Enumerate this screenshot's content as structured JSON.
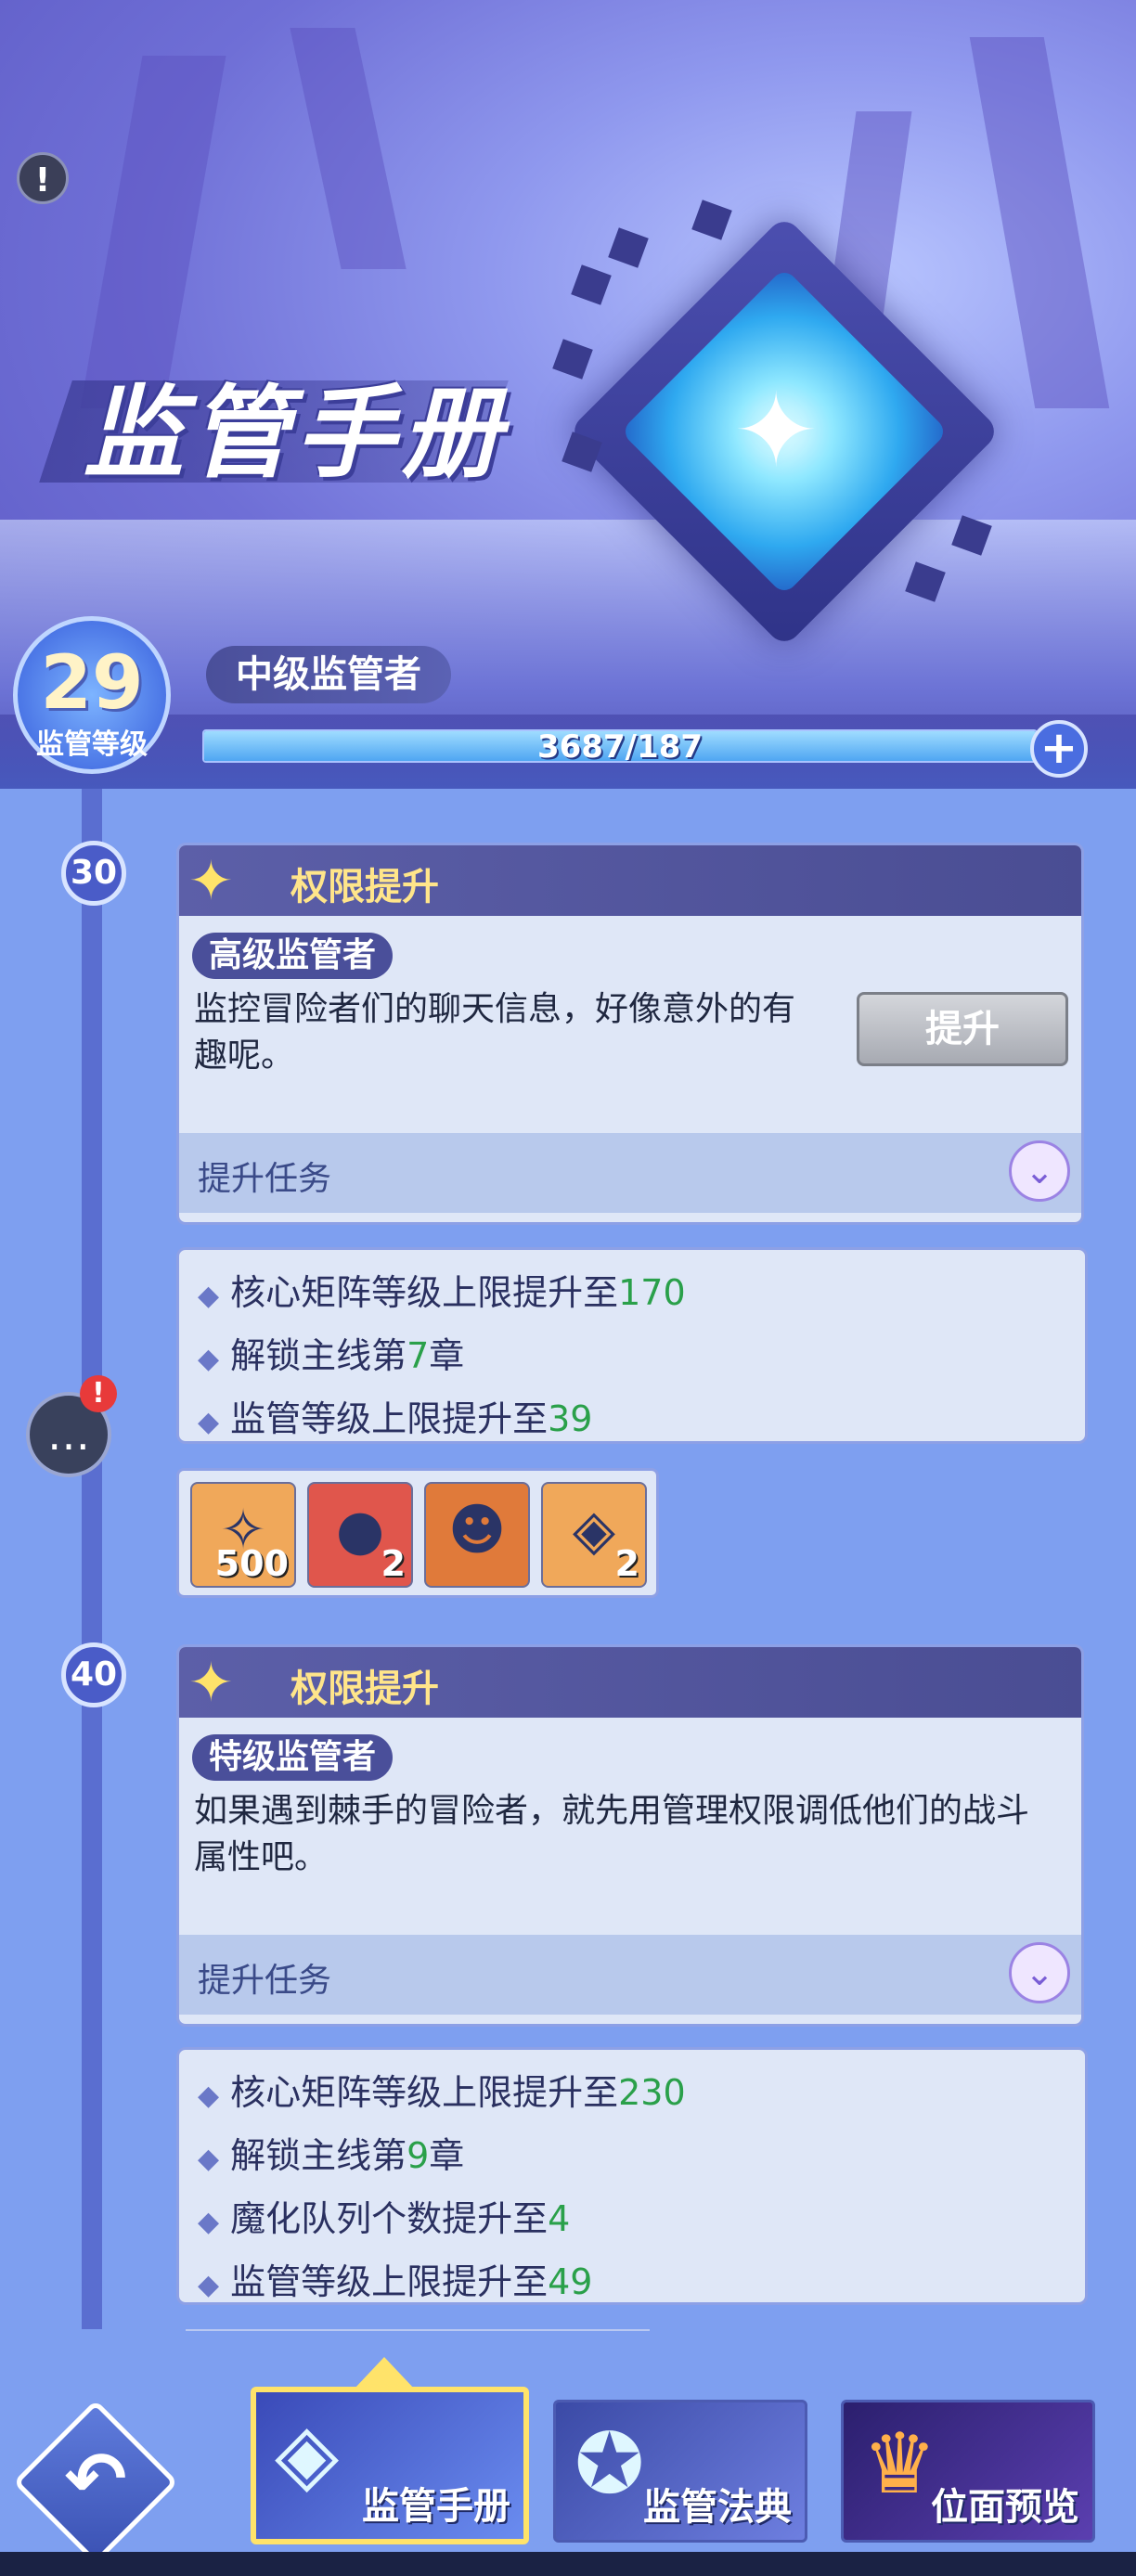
{
  "hero": {
    "title": "监管手册"
  },
  "level": {
    "value": "29",
    "label": "监管等级",
    "rank": "中级监管者",
    "xp_text": "3687/187",
    "xp_fill_fraction": 1.0
  },
  "tiers": [
    {
      "level": "30",
      "header": "权限提升",
      "rank": "高级监管者",
      "description": "监控冒险者们的聊天信息，好像意外的有趣呢。",
      "button": "提升",
      "task_label": "提升任务",
      "rewards_text": [
        {
          "text": "核心矩阵等级上限提升至",
          "num": "170"
        },
        {
          "text": "解锁主线第",
          "num": "7",
          "suffix": "章"
        },
        {
          "text": "监管等级上限提升至",
          "num": "39"
        }
      ],
      "items": [
        {
          "icon": "star-crystal-icon",
          "qty": "500",
          "bg": "#f0a85a"
        },
        {
          "icon": "orb-icon",
          "qty": "2",
          "bg": "#e0564c"
        },
        {
          "icon": "hero-portrait-icon",
          "qty": "",
          "bg": "#e07a3a"
        },
        {
          "icon": "cube-icon",
          "qty": "2",
          "bg": "#f0a85a"
        }
      ]
    },
    {
      "level": "40",
      "header": "权限提升",
      "rank": "特级监管者",
      "description": "如果遇到棘手的冒险者，就先用管理权限调低他们的战斗属性吧。",
      "task_label": "提升任务",
      "rewards_text": [
        {
          "text": "核心矩阵等级上限提升至",
          "num": "230"
        },
        {
          "text": "解锁主线第",
          "num": "9",
          "suffix": "章"
        },
        {
          "text": "魔化队列个数提升至",
          "num": "4"
        },
        {
          "text": "监管等级上限提升至",
          "num": "49"
        }
      ]
    }
  ],
  "nav": {
    "tabs": [
      {
        "label": "监管手册",
        "icon": "cube-icon",
        "active": true
      },
      {
        "label": "监管法典",
        "icon": "book-icon",
        "active": false
      },
      {
        "label": "位面预览",
        "icon": "crown-icon",
        "active": false
      }
    ]
  },
  "colors": {
    "accent_number": "#2aa04a",
    "header_gold": "#ffe58a",
    "active_tab_border": "#ffe36a"
  }
}
